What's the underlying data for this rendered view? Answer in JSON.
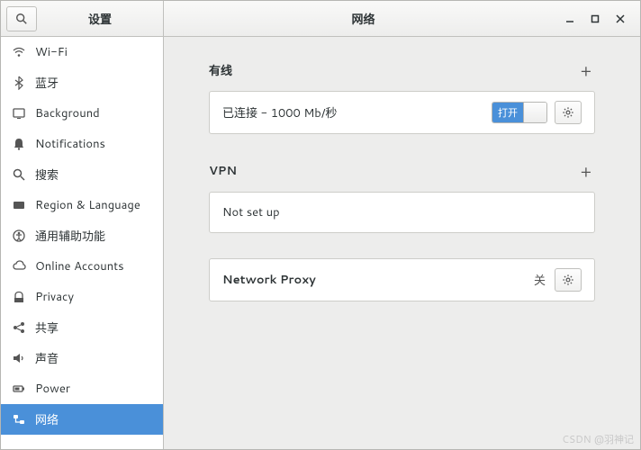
{
  "titlebar": {
    "left_title": "设置",
    "right_title": "网络"
  },
  "sidebar": {
    "items": [
      {
        "id": "wifi",
        "label": "Wi-Fi"
      },
      {
        "id": "bluetooth",
        "label": "蓝牙"
      },
      {
        "id": "background",
        "label": "Background"
      },
      {
        "id": "notifications",
        "label": "Notifications"
      },
      {
        "id": "search",
        "label": "搜索"
      },
      {
        "id": "region",
        "label": "Region & Language"
      },
      {
        "id": "accessibility",
        "label": "通用辅助功能"
      },
      {
        "id": "online-accounts",
        "label": "Online Accounts"
      },
      {
        "id": "privacy",
        "label": "Privacy"
      },
      {
        "id": "sharing",
        "label": "共享"
      },
      {
        "id": "sound",
        "label": "声音"
      },
      {
        "id": "power",
        "label": "Power"
      },
      {
        "id": "network",
        "label": "网络"
      }
    ],
    "selected": "network"
  },
  "content": {
    "wired": {
      "title": "有线",
      "status": "已连接 - 1000 Mb/秒",
      "toggle_label": "打开",
      "toggle_on": true
    },
    "vpn": {
      "title": "VPN",
      "status": "Not set up"
    },
    "proxy": {
      "label": "Network Proxy",
      "status": "关"
    }
  },
  "watermark": "CSDN @羽神记"
}
